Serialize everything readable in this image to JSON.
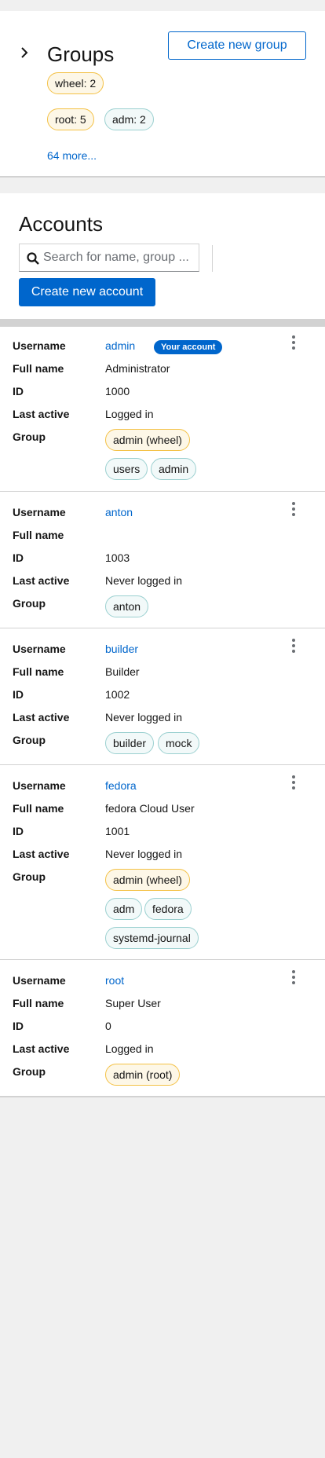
{
  "groups": {
    "title": "Groups",
    "create_button": "Create new group",
    "chips": [
      {
        "label": "wheel: 2",
        "variant": "warn"
      },
      {
        "label": "root: 5",
        "variant": "warn"
      },
      {
        "label": "adm: 2",
        "variant": "info"
      }
    ],
    "more_link": "64 more..."
  },
  "accounts": {
    "title": "Accounts",
    "search_placeholder": "Search for name, group ...",
    "create_button": "Create new account",
    "labels": {
      "username": "Username",
      "full_name": "Full name",
      "id": "ID",
      "last_active": "Last active",
      "group": "Group"
    },
    "your_account_badge": "Your account",
    "list": [
      {
        "username": "admin",
        "full_name": "Administrator",
        "id": "1000",
        "last_active": "Logged in",
        "groups": [
          {
            "label": "admin (wheel)",
            "variant": "warn"
          },
          {
            "label": "users",
            "variant": "info"
          },
          {
            "label": "admin",
            "variant": "info"
          }
        ]
      },
      {
        "username": "anton",
        "full_name": "",
        "id": "1003",
        "last_active": "Never logged in",
        "groups": [
          {
            "label": "anton",
            "variant": "info"
          }
        ]
      },
      {
        "username": "builder",
        "full_name": "Builder",
        "id": "1002",
        "last_active": "Never logged in",
        "groups": [
          {
            "label": "builder",
            "variant": "info"
          },
          {
            "label": "mock",
            "variant": "info"
          }
        ]
      },
      {
        "username": "fedora",
        "full_name": "fedora Cloud User",
        "id": "1001",
        "last_active": "Never logged in",
        "groups": [
          {
            "label": "admin (wheel)",
            "variant": "warn"
          },
          {
            "label": "adm",
            "variant": "info"
          },
          {
            "label": "fedora",
            "variant": "info"
          },
          {
            "label": "systemd-journal",
            "variant": "info"
          }
        ]
      },
      {
        "username": "root",
        "full_name": "Super User",
        "id": "0",
        "last_active": "Logged in",
        "groups": [
          {
            "label": "admin (root)",
            "variant": "warn"
          }
        ]
      }
    ]
  },
  "colors": {
    "link": "#0066cc",
    "warn_chip_border": "#f4c145",
    "info_chip_border": "#9bd0d0",
    "page_bg": "#f0f0f0"
  }
}
